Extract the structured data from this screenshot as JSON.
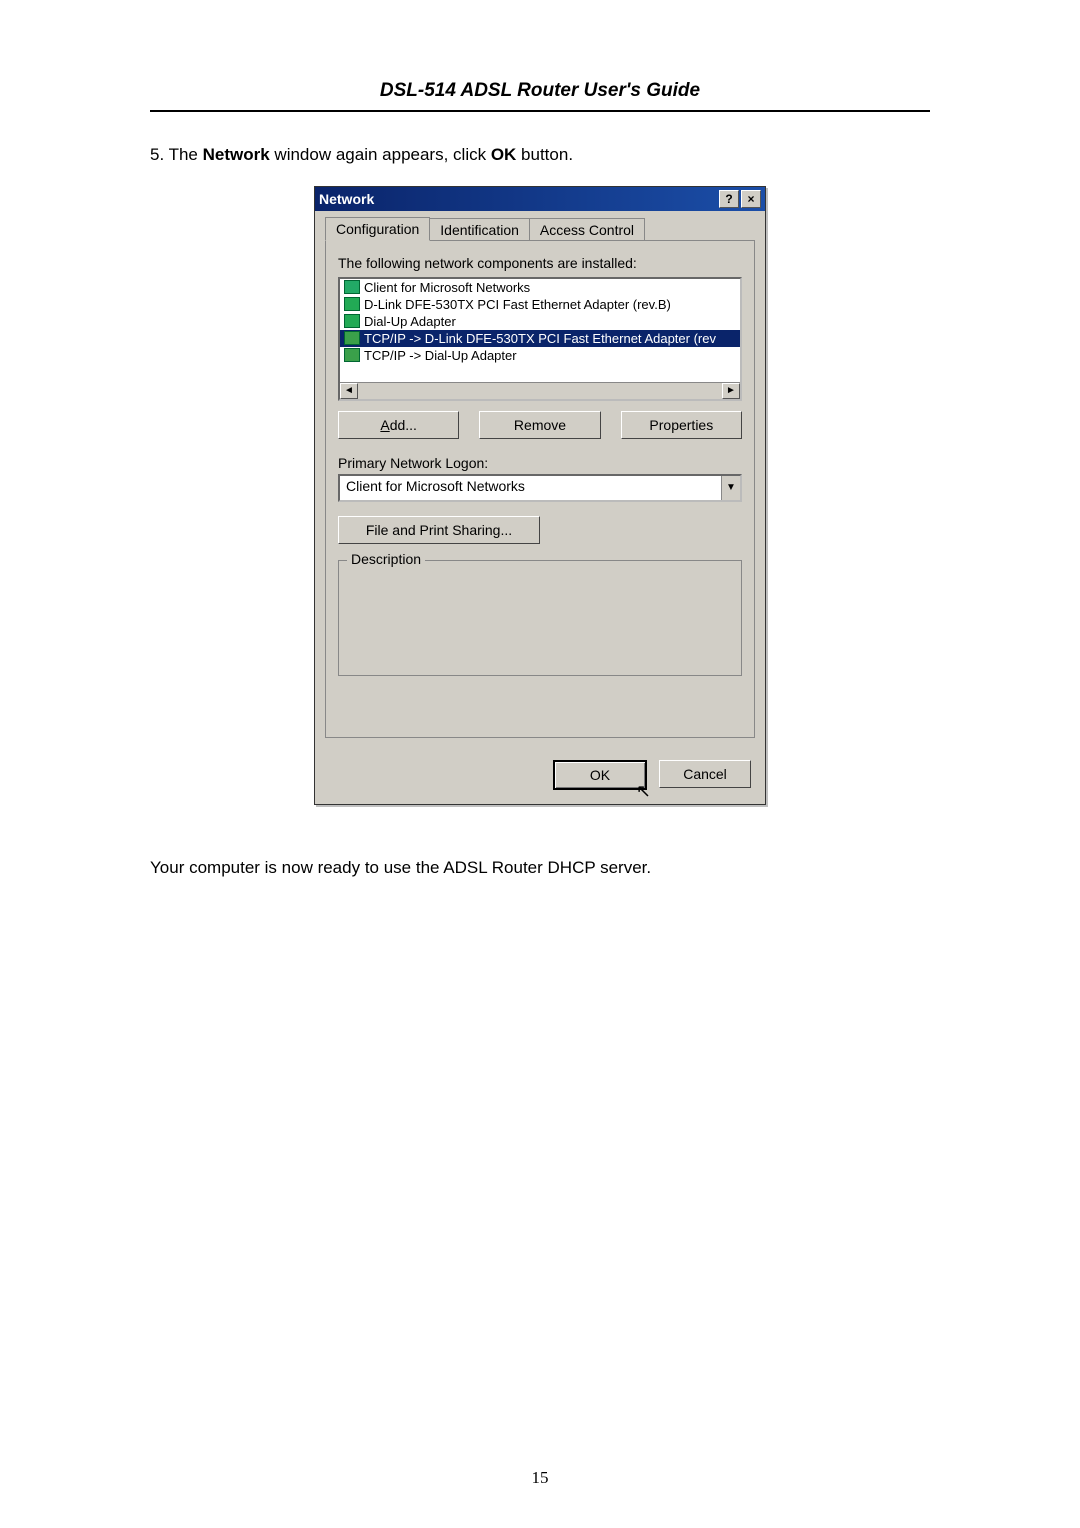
{
  "doc": {
    "header": "DSL-514 ADSL Router User's Guide",
    "step_prefix": "5. The ",
    "step_bold1": "Network",
    "step_mid": " window again appears, click ",
    "step_bold2": "OK",
    "step_suffix": " button.",
    "closing": "Your computer is now ready to use the ADSL Router DHCP server.",
    "page_number": "15"
  },
  "dlg": {
    "title": "Network",
    "help_glyph": "?",
    "close_glyph": "×",
    "tabs": [
      "Configuration",
      "Identification",
      "Access Control"
    ],
    "installed_label": "The following network components are installed:",
    "components": [
      "Client for Microsoft Networks",
      "D-Link DFE-530TX PCI Fast Ethernet Adapter (rev.B)",
      "Dial-Up Adapter",
      "TCP/IP -> D-Link DFE-530TX PCI Fast Ethernet Adapter (rev",
      "TCP/IP -> Dial-Up Adapter"
    ],
    "selected_index": 3,
    "scroll_left": "◄",
    "scroll_right": "►",
    "add_btn": "Add...",
    "remove_btn": "Remove",
    "properties_btn": "Properties",
    "primary_logon_label": "Primary Network Logon:",
    "primary_logon_value": "Client for Microsoft Networks",
    "dropdown_glyph": "▼",
    "file_print_btn": "File and Print Sharing...",
    "description_legend": "Description",
    "ok": "OK",
    "cancel": "Cancel",
    "cursor_glyph": "↖"
  }
}
